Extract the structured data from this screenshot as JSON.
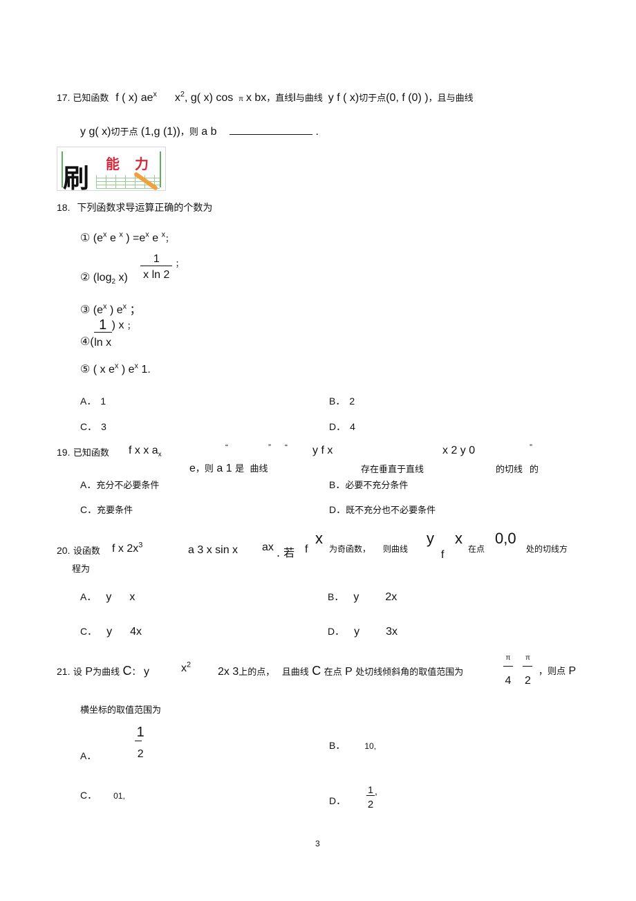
{
  "q17": {
    "num": "17.",
    "l1_a": "已知函数",
    "l1_b": "f ( x)   ae",
    "l1_b_sup": "x",
    "l1_c": "x",
    "l1_c_sup": "2",
    "l1_d": ", g( x)   cos",
    "l1_pi": "π",
    "l1_e": "x  bx",
    "l1_f": "，直线",
    "l1_g": "l",
    "l1_h": "与曲线",
    "l1_i": "y     f ( x)",
    "l1_j": "切于点",
    "l1_k": "(0, f (0) )",
    "l1_l": "，且与曲线",
    "l2_a": "y   g( x)",
    "l2_b": "切于点",
    "l2_c": "(1,g (1))",
    "l2_d": "，则",
    "l2_e": "a     b",
    "l2_end": "."
  },
  "logo": {
    "char_main": "刷",
    "char_1": "能",
    "char_2": "力"
  },
  "q18": {
    "num": "18.",
    "stem": "下列函数求导运算正确的个数为",
    "items": [
      {
        "mark": "①",
        "text": "(e",
        "parts": [
          "x",
          "   e ",
          "x",
          " ) =e",
          "x",
          "    e ",
          "x",
          "；"
        ]
      },
      {
        "mark": "②",
        "pre": "(log",
        "sub": "2",
        "post": " x)",
        "num": "1",
        "den": "x ln 2",
        "end": "；"
      },
      {
        "mark": "③",
        "pre": "(e",
        "sup": "x",
        "mid": " )     e",
        "sup2": "x",
        "end": "；"
      },
      {
        "mark": "④",
        "num": "1",
        "den": "ln x",
        "post": ")   x",
        "end": "；"
      },
      {
        "mark": "⑤",
        "pre": "( x e",
        "sup": "x",
        "mid": " )     e",
        "sup2": "x",
        "end": "   1."
      }
    ],
    "options": [
      {
        "label": "A．",
        "text": "1"
      },
      {
        "label": "B．",
        "text": "2"
      },
      {
        "label": "C．",
        "text": "3"
      },
      {
        "label": "D．",
        "text": "4"
      }
    ]
  },
  "q19": {
    "num": "19.",
    "stem_a": "已知函数",
    "stem_b": "f x       x   a",
    "stem_b_sub": "x",
    "q_open1": "“",
    "q_close1": "”",
    "q_open2": "“",
    "stem_c": "y   f  x",
    "stem_d": "x   2 y   0",
    "q_close2": "”",
    "l2_e": "e",
    "l2_then": "，则",
    "l2_a": "a      1",
    "l2_is": "是",
    "l2_curve": "曲线",
    "l2_exist": "存在垂直于直线",
    "l2_tangent": "的切线",
    "l2_of": "的",
    "options": [
      {
        "label": "A．",
        "text": "充分不必要条件"
      },
      {
        "label": "B．",
        "text": "必要不充分条件"
      },
      {
        "label": "C．",
        "text": "充要条件"
      },
      {
        "label": "D．",
        "text": "既不充分也不必要条件"
      }
    ]
  },
  "q20": {
    "num": "20.",
    "stem_a": "设函数",
    "stem_b": "f   x      2x",
    "stem_b_sup": "3",
    "stem_c": "a    3 x sin x",
    "stem_d": "ax",
    "stem_e": ". 若",
    "stem_f": "f",
    "stem_x": "x",
    "stem_g": "为奇函数，",
    "stem_h": "则曲线",
    "stem_y": "y",
    "stem_f2": "f",
    "stem_x2": "x",
    "stem_i": "在点",
    "stem_pt": "0,0",
    "stem_j": "处的切线方",
    "stem_k": "程为",
    "options": [
      {
        "label": "A．",
        "y": "y",
        "rhs": "x"
      },
      {
        "label": "B．",
        "y": "y",
        "rhs": "2x"
      },
      {
        "label": "C．",
        "y": "y",
        "rhs": "4x"
      },
      {
        "label": "D．",
        "y": "y",
        "rhs": "3x"
      }
    ]
  },
  "q21": {
    "num": "21.",
    "stem_a": "设",
    "P": "P",
    "stem_b": "为曲线",
    "C": "C",
    "stem_c": "：",
    "stem_y": "y",
    "stem_x2": "x",
    "stem_x2_sup": "2",
    "stem_d": "2x  3",
    "stem_e": "上的点，",
    "stem_f": "且曲线",
    "stem_g": "在点",
    "stem_h": "处切线倾斜角的取值范围为",
    "range_num1": "π",
    "range_den1": "4",
    "range_num2": "π",
    "range_den2": "2",
    "stem_i": "，则点",
    "stem_j": "横坐标的取值范围为",
    "options": [
      {
        "label": "A．",
        "num": "1",
        "den": "2"
      },
      {
        "label": "B．",
        "text": "10,"
      },
      {
        "label": "C．",
        "text": "01,"
      },
      {
        "label": "D．",
        "num": "1",
        "den": "2",
        "tail": ","
      }
    ]
  },
  "page_number": "3"
}
